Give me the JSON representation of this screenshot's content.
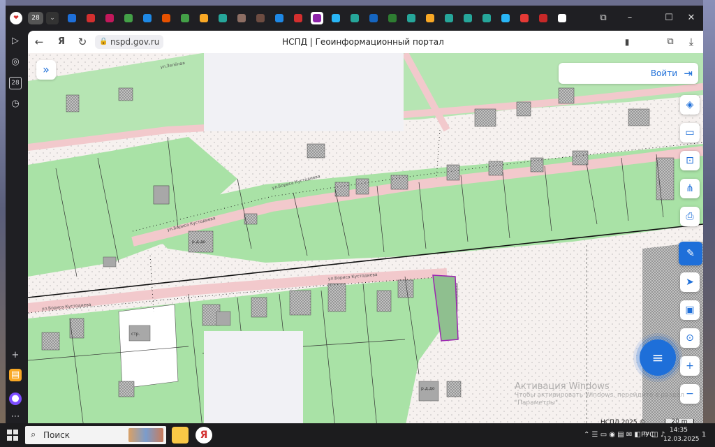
{
  "browser": {
    "tab_count": "28",
    "tab_icon_colors": [
      "#1e6fd9",
      "#d32f2f",
      "#c2185b",
      "#43a047",
      "#1e88e5",
      "#e65100",
      "#43a047",
      "#f9a825",
      "#26a69a",
      "#8d6e63",
      "#6d4c41",
      "#1e88e5",
      "#d32f2f",
      "#8e24aa",
      "#29b6f6",
      "#26a69a",
      "#1565c0",
      "#2e7d32",
      "#26a69a",
      "#f9a825",
      "#26a69a",
      "#26a69a",
      "#26a69a",
      "#29b6f6",
      "#e53935",
      "#c62828",
      "#ffffff"
    ],
    "url_domain": "nspd.gov.ru",
    "page_title": "НСПД | Геоинформационный портал",
    "yandex_letter": "Я"
  },
  "map": {
    "login_label": "Войти",
    "attribution": "НСПД 2025 ©",
    "scale_label": "20 m",
    "street_labels": [
      "ул.Зелёная",
      "ул.Бориса Кустодиева",
      "ул.Бориса Кустодиева",
      "ул.Бориса Кустодиева",
      "ул.Бориса Кустодиева"
    ],
    "building_labels": [
      "стр.",
      "р.д.до",
      "р.д.до"
    ],
    "accent_color": "#1e6fd9",
    "parcel_color": "#9be09b",
    "highlight_color": "#9c27b0"
  },
  "watermark": {
    "title": "Активация Windows",
    "subtitle": "Чтобы активировать Windows, перейдите в раздел \"Параметры\"."
  },
  "taskbar": {
    "search_label": "Поиск",
    "language": "РУС",
    "time": "14:35",
    "date": "12.03.2025",
    "notification_count": "1"
  }
}
